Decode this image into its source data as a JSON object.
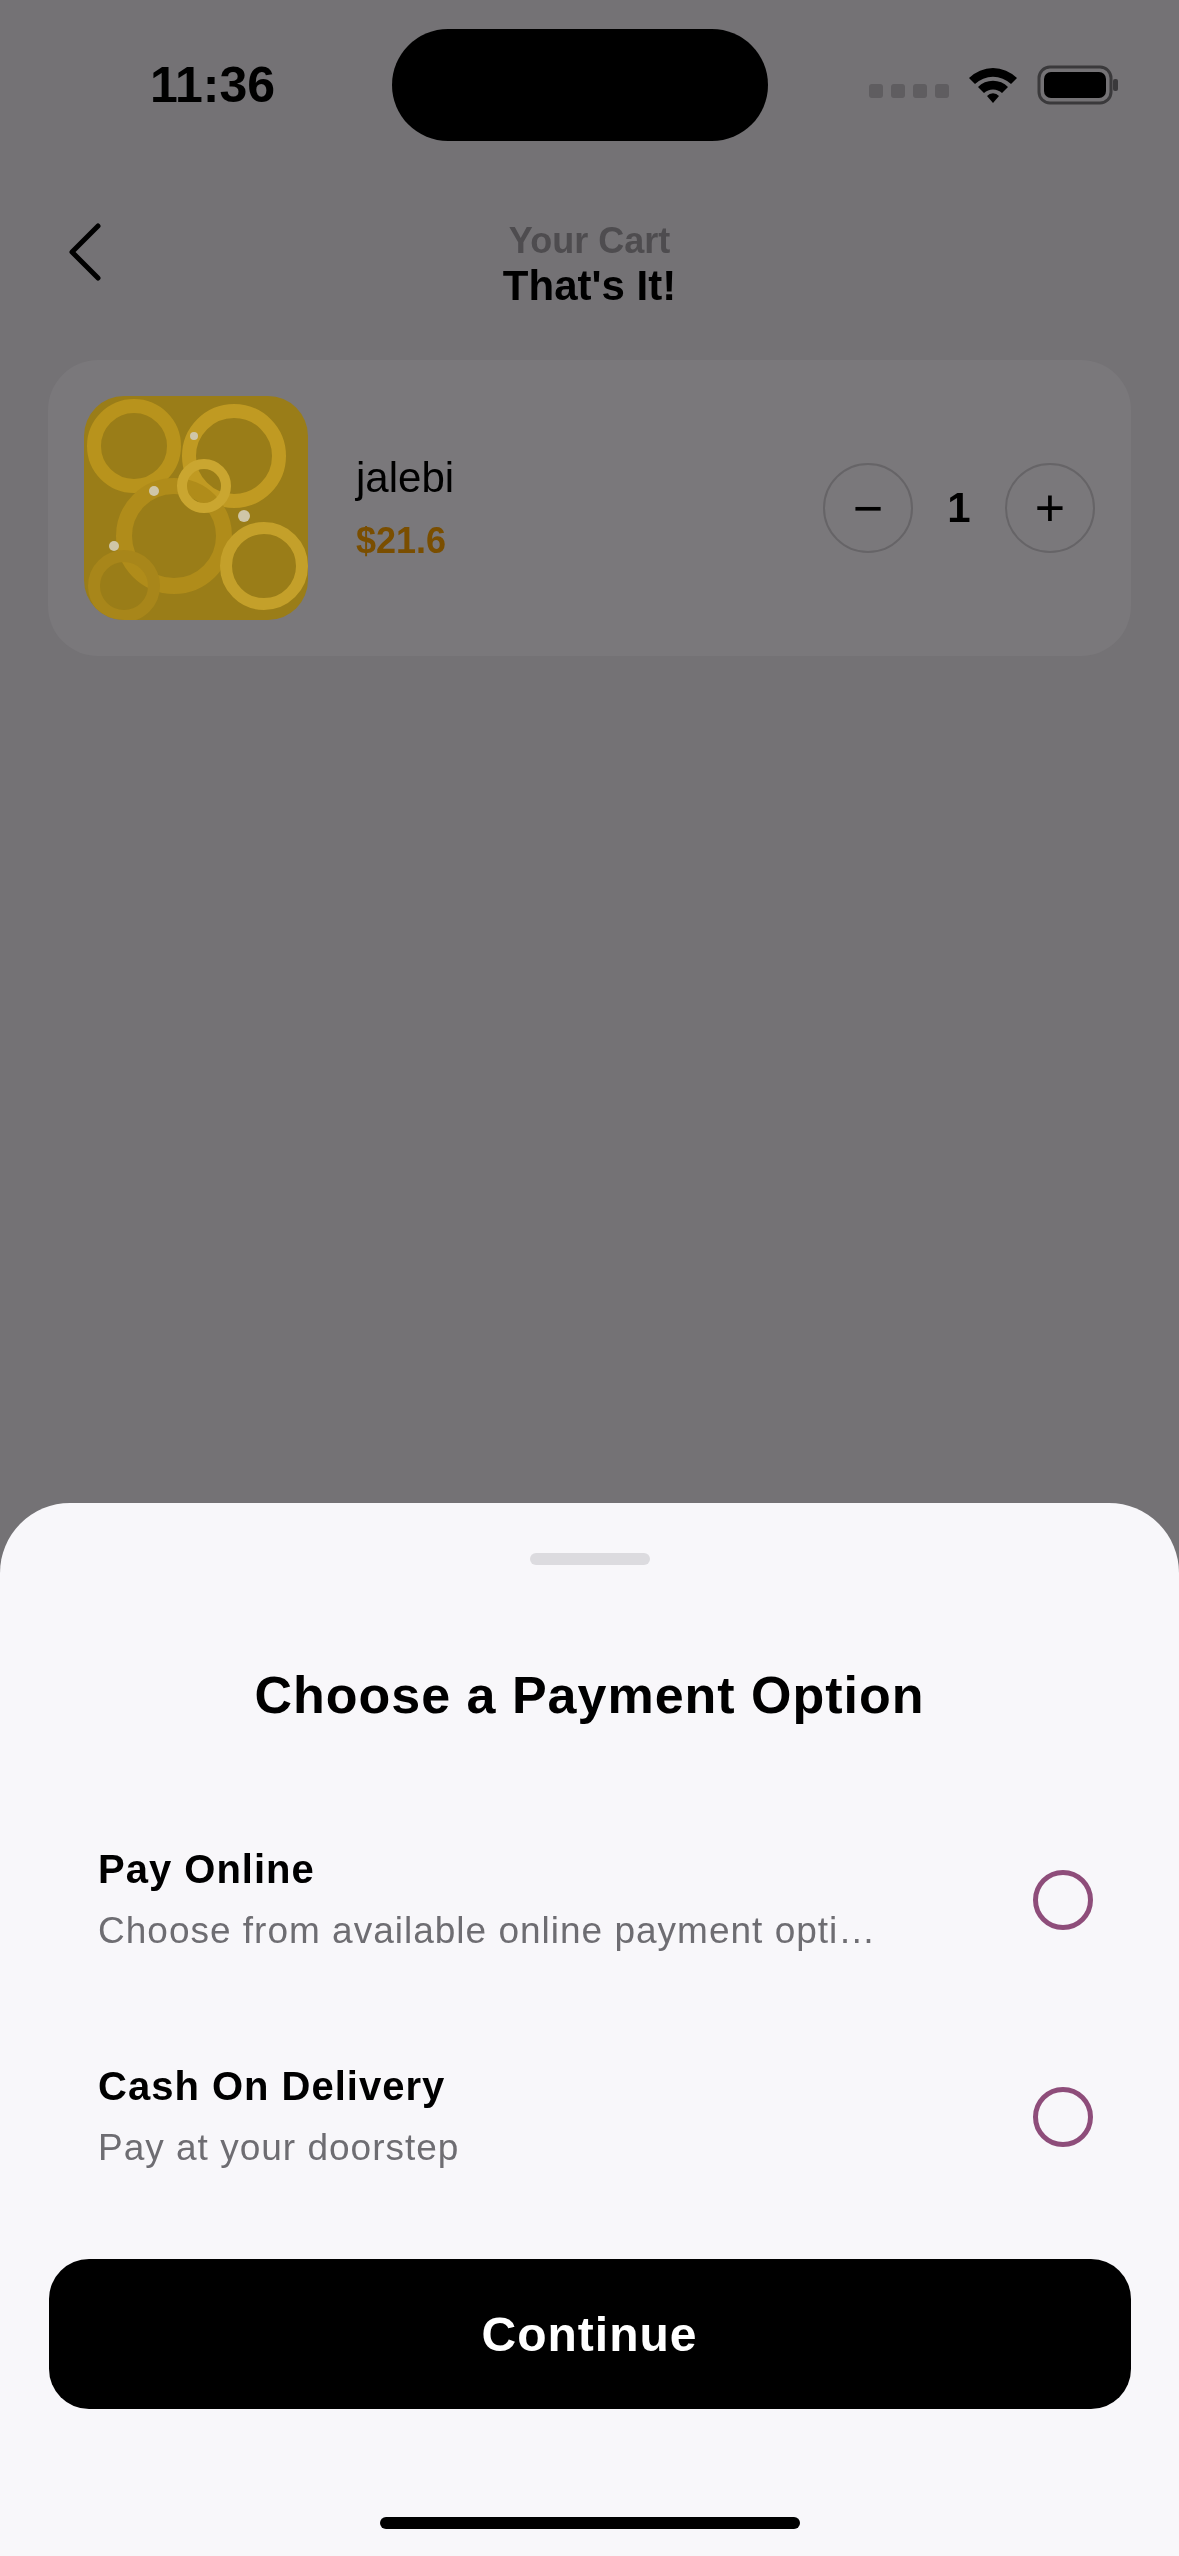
{
  "status_bar": {
    "time": "11:36"
  },
  "header": {
    "subtitle": "Your Cart",
    "title": "That's It!"
  },
  "cart_items": [
    {
      "name": "jalebi",
      "price": "$21.6",
      "quantity": "1",
      "decrement": "−",
      "increment": "+"
    }
  ],
  "payment_sheet": {
    "title": "Choose a Payment Option",
    "options": [
      {
        "title": "Pay Online",
        "description": "Choose from available online payment opti…",
        "selected": false
      },
      {
        "title": "Cash On Delivery",
        "description": "Pay at your doorstep",
        "selected": false
      }
    ],
    "continue_button": "Continue"
  }
}
